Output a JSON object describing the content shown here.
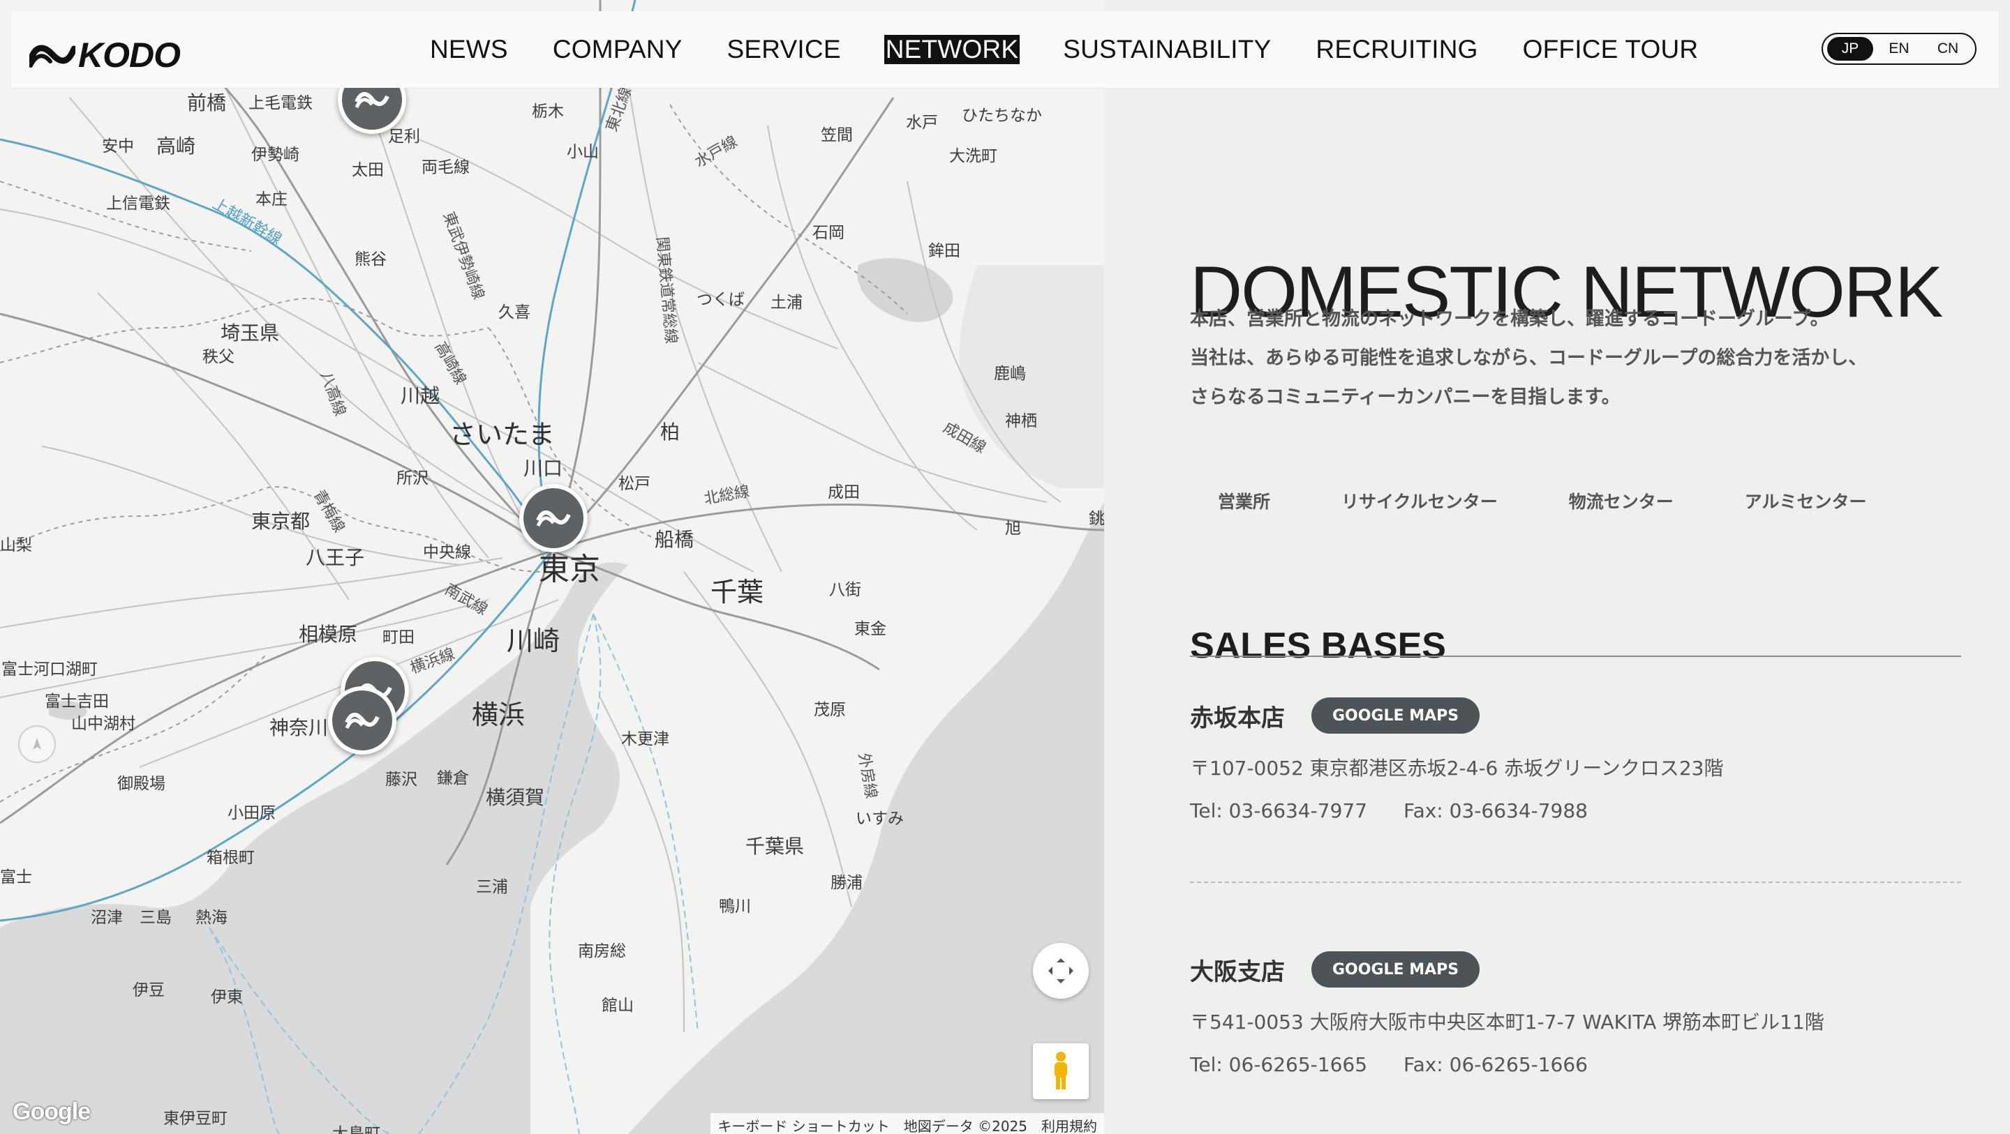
{
  "header": {
    "logo_text": "KODO",
    "nav": [
      {
        "label": "NEWS",
        "active": false
      },
      {
        "label": "COMPANY",
        "active": false
      },
      {
        "label": "SERVICE",
        "active": false
      },
      {
        "label": "NETWORK",
        "active": true
      },
      {
        "label": "SUSTAINABILITY",
        "active": false
      },
      {
        "label": "RECRUITING",
        "active": false
      },
      {
        "label": "OFFICE TOUR",
        "active": false
      }
    ],
    "languages": [
      "JP",
      "EN",
      "CN"
    ],
    "current_language": "JP"
  },
  "map": {
    "labels": {
      "maebashi": "前橋",
      "joumou": "上毛電鉄",
      "annaka": "安中",
      "takasaki": "高崎",
      "isesaki": "伊勢崎",
      "ashikaga": "足利",
      "ota": "太田",
      "ryomo": "両毛線",
      "tochigi": "栃木",
      "oyama": "小山",
      "tohoku": "東北線",
      "kasama": "笠間",
      "mito": "水戸",
      "hitachinaka": "ひたちなか",
      "suifu": "水戸線",
      "oarai": "大洗町",
      "honjo": "本庄",
      "joshin": "上信電鉄",
      "joetsu": "上越新幹線",
      "kumagaya": "熊谷",
      "tobu": "東武伊勢崎線",
      "kuki": "久喜",
      "kanto": "関東鉄道常総線",
      "tsukuba": "つくば",
      "tsuchiura": "土浦",
      "ishioka": "石岡",
      "hokota": "鉾田",
      "saitama_pref": "埼玉県",
      "chichibu": "秩父",
      "takasaki_line": "高崎線",
      "hachiko": "八高線",
      "kawagoe": "川越",
      "saitama": "さいたま",
      "kawaguchi": "川口",
      "kashiwa": "柏",
      "kashima": "鹿嶋",
      "kamisu": "神栖",
      "narita_line": "成田線",
      "tokorozawa": "所沢",
      "matsudo": "松戸",
      "hokuso": "北総線",
      "narita": "成田",
      "ome": "青梅線",
      "tokyo_pref": "東京都",
      "hachioji": "八王子",
      "chuo": "中央線",
      "tokyo": "東京",
      "funabashi": "船橋",
      "asahi": "旭",
      "yamanashi": "山梨",
      "chiba": "千葉",
      "yachimata": "八街",
      "nanbu": "南武線",
      "togane": "東金",
      "sagamihara": "相模原",
      "machida": "町田",
      "kawasaki": "川崎",
      "yokohama_line": "横浜線",
      "fujikawaguchiko": "富士河口湖町",
      "fujiyoshida": "富士吉田",
      "yamanakako": "山中湖村",
      "kanagawa": "神奈川",
      "yokohama": "横浜",
      "mobara": "茂原",
      "kisarazu": "木更津",
      "sotobo": "外房線",
      "gotemba": "御殿場",
      "fujisawa": "藤沢",
      "kamakura": "鎌倉",
      "yokosuka": "横須賀",
      "isumi": "いすみ",
      "odawara": "小田原",
      "hakone": "箱根町",
      "chiba_pref": "千葉県",
      "katsuura": "勝浦",
      "fuji": "富士",
      "miura": "三浦",
      "numazu": "沼津",
      "mishima": "三島",
      "atami": "熱海",
      "kamogawa": "鴨川",
      "minamiboso": "南房総",
      "izu": "伊豆",
      "ito": "伊東",
      "tateyama": "館山",
      "higashiizu": "東伊豆町",
      "oshima": "大島町",
      "choshi": "銚"
    },
    "markers_count": 5,
    "attribution": [
      "キーボード ショートカット",
      "地図データ ©2025",
      "利用規約"
    ],
    "provider_logo": "Google"
  },
  "main": {
    "title": "DOMESTIC NETWORK",
    "intro": [
      "本店、営業所と物流のネットワークを構築し、躍進するコードーグループ。",
      "当社は、あらゆる可能性を追求しながら、コードーグループの総合力を活かし、",
      "さらなるコミュニティーカンパニーを目指します。"
    ],
    "categories": [
      "営業所",
      "リサイクルセンター",
      "物流センター",
      "アルミセンター"
    ],
    "section_title": "SALES BASES",
    "offices": [
      {
        "name": "赤坂本店",
        "button": "GOOGLE MAPS",
        "address": "〒107-0052 東京都港区赤坂2-4-6 赤坂グリーンクロス23階",
        "tel": "Tel: 03-6634-7977",
        "fax": "Fax: 03-6634-7988"
      },
      {
        "name": "大阪支店",
        "button": "GOOGLE MAPS",
        "address": "〒541-0053 大阪府大阪市中央区本町1-7-7 WAKITA 堺筋本町ビル11階",
        "tel": "Tel: 06-6265-1665",
        "fax": "Fax: 06-6265-1666"
      }
    ]
  }
}
